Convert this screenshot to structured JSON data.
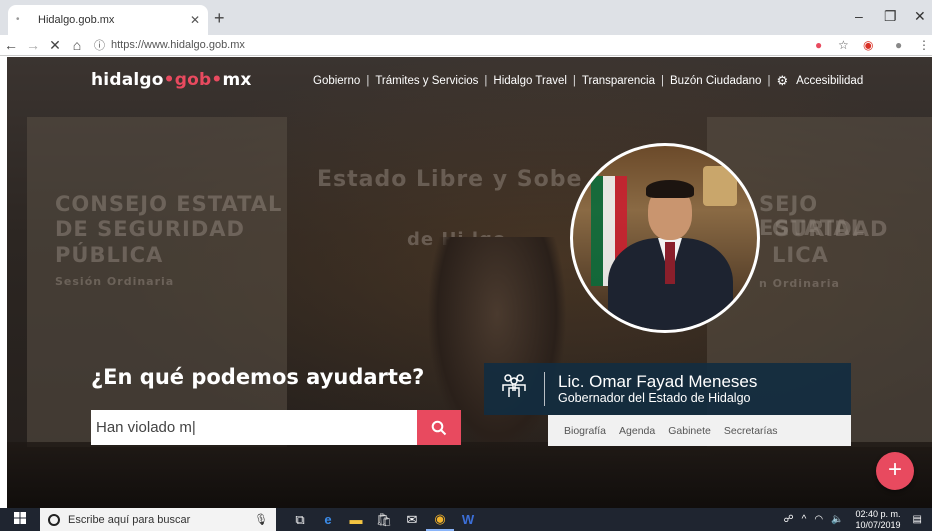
{
  "browser": {
    "tab_title": "Hidalgo.gob.mx",
    "url": "https://www.hidalgo.gob.mx",
    "icons": [
      "back-icon",
      "forward-icon",
      "stop-icon",
      "home-icon",
      "info-icon",
      "extension-icon",
      "star-icon",
      "account-icon",
      "menu-icon"
    ]
  },
  "site": {
    "logo": {
      "part1": "hidalgo",
      "dot1": "•",
      "part2": "gob",
      "dot2": "•",
      "part3": "mx"
    },
    "nav": [
      "Gobierno",
      "Trámites y Servicios",
      "Hidalgo Travel",
      "Transparencia",
      "Buzón Ciudadano",
      "Accesibilidad"
    ],
    "bg_text": {
      "left1": "CONSEJO ESTATAL",
      "left2": "DE SEGURIDAD",
      "left3": "PÚBLICA",
      "left4": "Sesión Ordinaria",
      "center": "Estado Libre y Sobe",
      "center2": "de Hi    lgo",
      "right1": "SEJO ESTATAL",
      "right2": "GURIDAD",
      "right3": "LICA",
      "right4": "n Ordinaria"
    },
    "headline": "¿En qué podemos ayudarte?",
    "search_value": "Han violado m|",
    "governor": {
      "name": "Lic. Omar Fayad Meneses",
      "role": "Gobernador del Estado de Hidalgo",
      "links": [
        "Biografía",
        "Agenda",
        "Gabinete",
        "Secretarías"
      ]
    },
    "fab_label": "+",
    "accent_color": "#e84a5f"
  },
  "taskbar": {
    "search_placeholder": "Escribe aquí para buscar",
    "time": "02:40 p. m.",
    "date": "10/07/2019"
  }
}
